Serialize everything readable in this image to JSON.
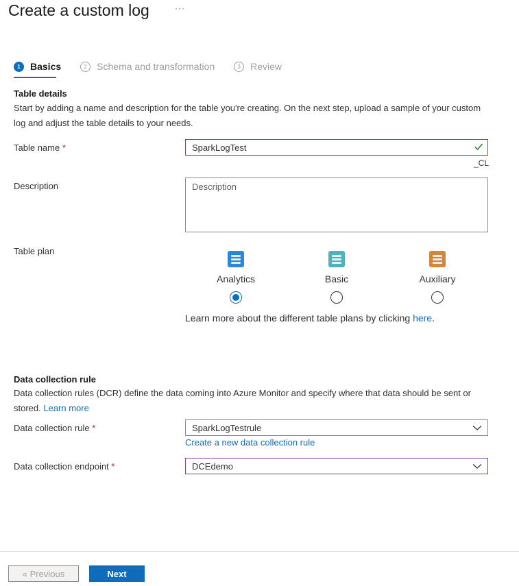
{
  "header": {
    "title": "Create a custom log",
    "more_label": "···"
  },
  "steps": [
    {
      "number": "1",
      "label": "Basics",
      "state": "active"
    },
    {
      "number": "2",
      "label": "Schema and transformation",
      "state": "inactive"
    },
    {
      "number": "3",
      "label": "Review",
      "state": "inactive"
    }
  ],
  "table_details": {
    "title": "Table details",
    "description": "Start by adding a name and description for the table you're creating. On the next step, upload a sample of your custom log and adjust the table details to your needs.",
    "table_name": {
      "label": "Table name",
      "required": "*",
      "value": "SparkLogTest",
      "suffix": "_CL",
      "valid_icon": "checkmark-icon"
    },
    "description_field": {
      "label": "Description",
      "placeholder": "Description"
    },
    "table_plan": {
      "label": "Table plan",
      "options": [
        {
          "name": "Analytics",
          "selected": true,
          "color": "#2b88d8"
        },
        {
          "name": "Basic",
          "selected": false,
          "color": "#4fb3bf"
        },
        {
          "name": "Auxiliary",
          "selected": false,
          "color": "#d4873a"
        }
      ],
      "note_prefix": "Learn more about the different table plans by clicking ",
      "note_link": "here",
      "note_suffix": "."
    }
  },
  "dcr": {
    "title": "Data collection rule",
    "description_prefix": "Data collection rules (DCR) define the data coming into Azure Monitor and specify where that data should be sent or stored. ",
    "learn_more": "Learn more",
    "rule": {
      "label": "Data collection rule",
      "required": "*",
      "value": "SparkLogTestrule",
      "create_link": "Create a new data collection rule"
    },
    "endpoint": {
      "label": "Data collection endpoint",
      "required": "*",
      "value": "DCEdemo"
    }
  },
  "footer": {
    "previous_label": "« Previous",
    "next_label": "Next"
  },
  "colors": {
    "accent": "#0f6cbd",
    "focus_border": "#7c3fa8",
    "required": "#a4262c",
    "valid": "#107c10"
  }
}
